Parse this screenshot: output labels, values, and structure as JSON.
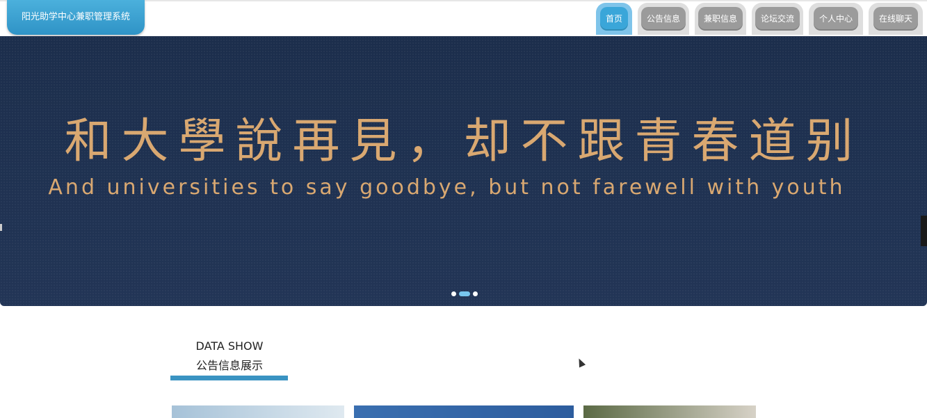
{
  "header": {
    "logo_text": "阳光助学中心兼职管理系统",
    "nav": [
      {
        "label": "首页",
        "active": true
      },
      {
        "label": "公告信息",
        "active": false
      },
      {
        "label": "兼职信息",
        "active": false
      },
      {
        "label": "论坛交流",
        "active": false
      },
      {
        "label": "个人中心",
        "active": false
      },
      {
        "label": "在线聊天",
        "active": false
      }
    ]
  },
  "banner": {
    "title": "和大學說再見，却不跟青春道别",
    "subtitle": "And universities to say goodbye, but not farewell with youth",
    "slides": 3,
    "active_slide": 2
  },
  "section": {
    "title_en": "DATA SHOW",
    "title_zh": "公告信息展示"
  },
  "colors": {
    "accent": "#3a93c2",
    "banner_bg": "#1f3150",
    "banner_text": "#d9a871"
  }
}
